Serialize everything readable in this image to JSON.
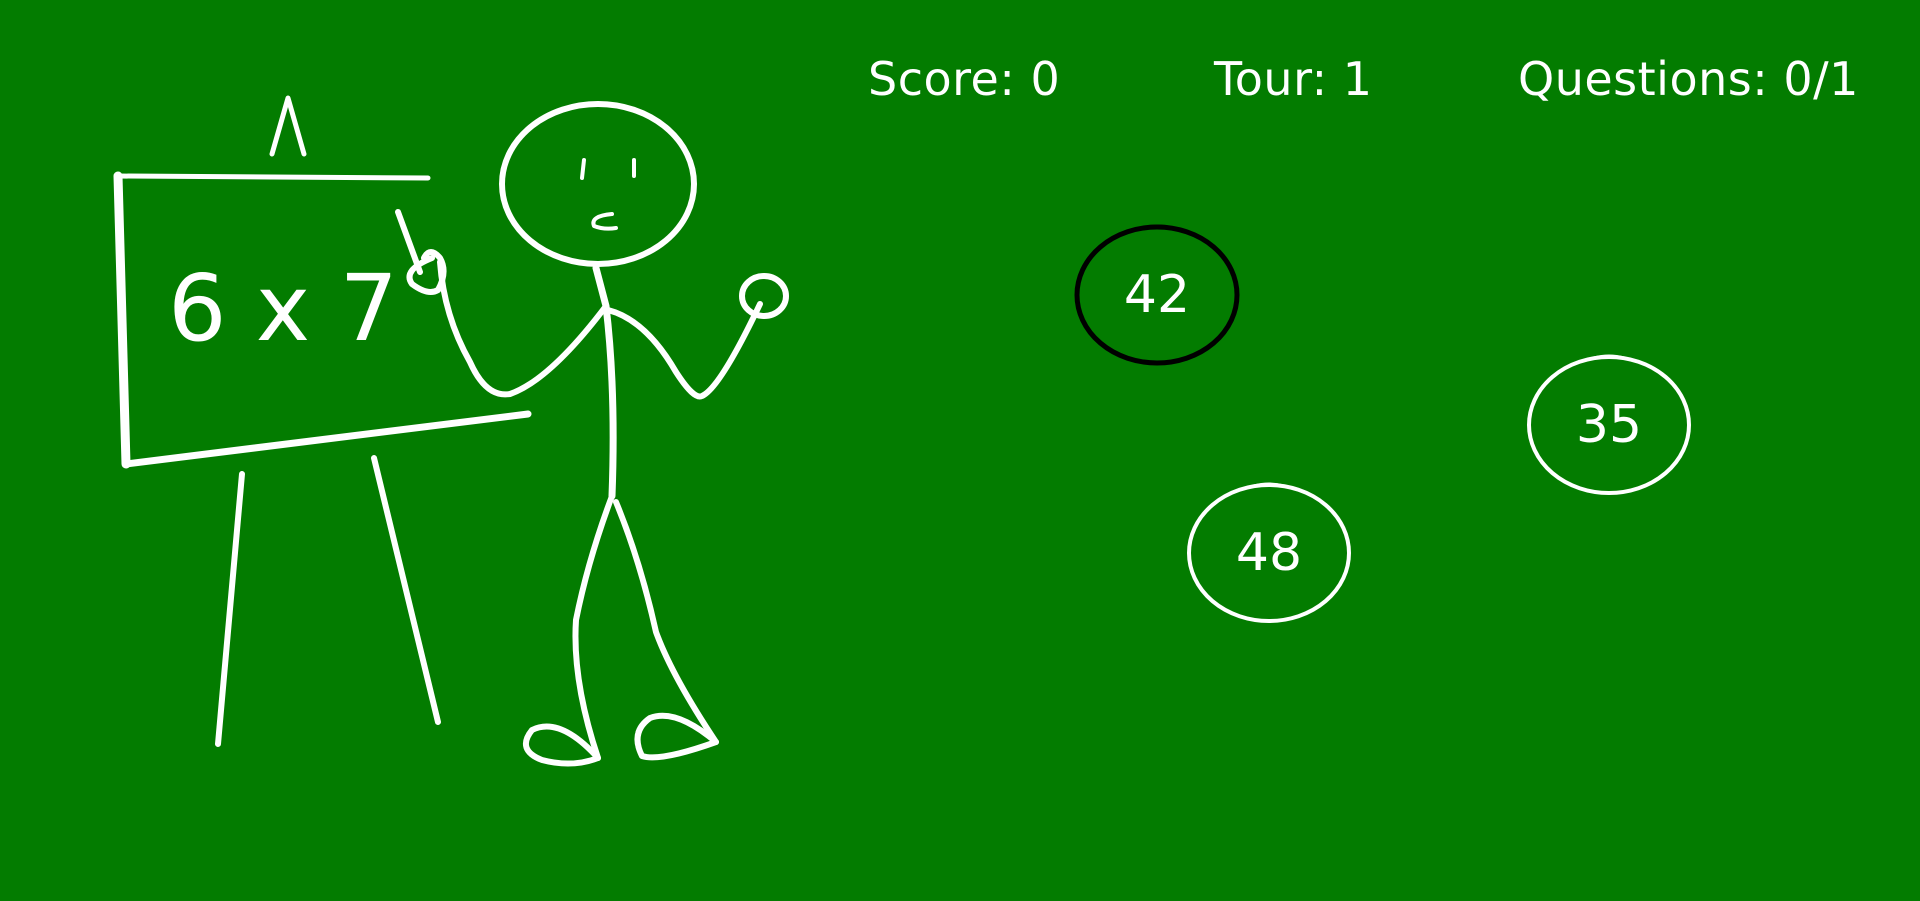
{
  "hud": {
    "score": "Score: 0",
    "round": "Tour: 1",
    "questions": "Questions: 0/1"
  },
  "board": {
    "question": "6 x 7"
  },
  "answers": [
    {
      "value": "42",
      "highlighted": true
    },
    {
      "value": "48",
      "highlighted": false
    },
    {
      "value": "35",
      "highlighted": false
    }
  ],
  "colors": {
    "background": "#037c00",
    "chalk": "#ffffff",
    "highlight": "#000000"
  }
}
